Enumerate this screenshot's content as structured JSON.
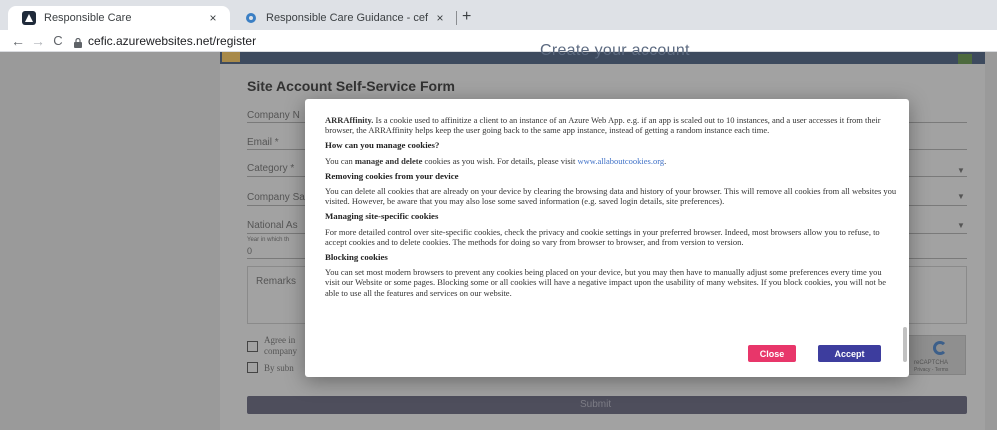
{
  "browser": {
    "tabs": [
      {
        "title": "Responsible Care",
        "close": "×"
      },
      {
        "title": "Responsible Care Guidance - cef",
        "close": "×"
      }
    ],
    "new_tab": "+",
    "url": "cefic.azurewebsites.net/register",
    "nav": {
      "back": "←",
      "forward": "→",
      "reload": "C"
    }
  },
  "page": {
    "header_title": "Create your account",
    "form_title": "Site Account Self-Service Form",
    "fields": {
      "company_name": "Company N",
      "email": "Email *",
      "category": "Category *",
      "company_sa": "Company Sa",
      "national_as": "National As",
      "year_label": "Year in which th",
      "year_value": "0",
      "remarks": "Remarks"
    },
    "checkboxes": {
      "agree_line1": "Agree in",
      "agree_line2": "company",
      "by_sub": "By subn"
    },
    "submit": "Submit",
    "recaptcha_text": "reCAPTCHA",
    "recaptcha_sub": "Privacy - Terms"
  },
  "cookie_modal": {
    "intro_bold": "ARRAffinity.",
    "intro_text": " Is a cookie used to affinitize a client to an instance of an Azure Web App. e.g. if an app is scaled out to 10 instances, and a user accesses it from their browser, the ARRAffinity helps keep the user going back to the same app instance, instead of getting a random instance each time.",
    "h_manage": "How can you manage cookies?",
    "manage_pre": "You can ",
    "manage_bold": "manage and delete",
    "manage_mid": " cookies as you wish. For details, please visit ",
    "manage_link": "www.allaboutcookies.org",
    "manage_end": ".",
    "h_remove": "Removing cookies from your device",
    "remove_text": "You can delete all cookies that are already on your device by clearing the browsing data and history of your browser. This will remove all cookies from all websites you visited. However, be aware that you may also lose some saved information (e.g. saved login details, site preferences).",
    "h_site": "Managing site-specific cookies",
    "site_text": "For more detailed control over site-specific cookies, check the privacy and cookie settings in your preferred browser. Indeed, most browsers allow you to refuse, to accept cookies and to delete cookies. The methods for doing so vary from browser to browser, and from version to version.",
    "h_block": "Blocking cookies",
    "block_text": "You can set most modern browsers to prevent any cookies being placed on your device, but you may then have to manually adjust some preferences every time you visit our Website or some pages. Blocking some or all cookies will have a negative impact upon the usability of many websites. If you block cookies, you will not be able to use all the features and services on our website.",
    "close_label": "Close",
    "accept_label": "Accept"
  },
  "colors": {
    "close_button": "#e8366a",
    "accept_button": "#3d3d9e",
    "link": "#3f71c7"
  }
}
